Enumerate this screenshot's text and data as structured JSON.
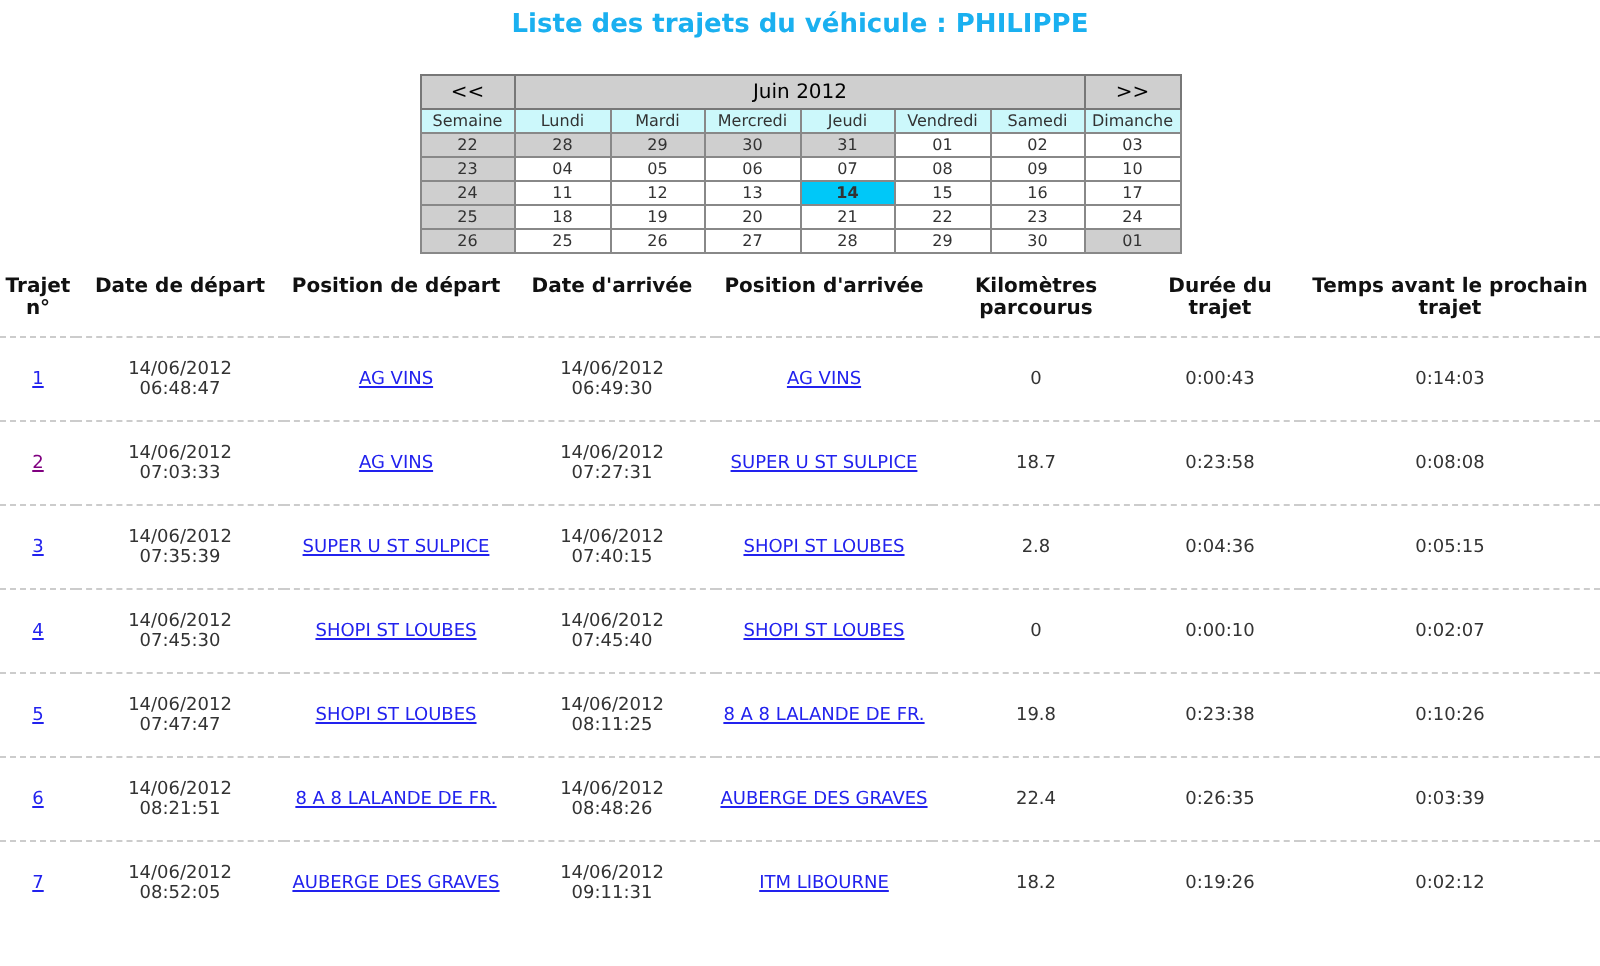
{
  "title": "Liste des trajets du véhicule : PHILIPPE",
  "calendar": {
    "prev": "<<",
    "month": "Juin 2012",
    "next": ">>",
    "week_header": "Semaine",
    "weekdays": [
      "Lundi",
      "Mardi",
      "Mercredi",
      "Jeudi",
      "Vendredi",
      "Samedi",
      "Dimanche"
    ],
    "weeks": [
      {
        "week": "22",
        "days": [
          {
            "day": "28",
            "outside": true,
            "selected": false
          },
          {
            "day": "29",
            "outside": true,
            "selected": false
          },
          {
            "day": "30",
            "outside": true,
            "selected": false
          },
          {
            "day": "31",
            "outside": true,
            "selected": false
          },
          {
            "day": "01",
            "outside": false,
            "selected": false
          },
          {
            "day": "02",
            "outside": false,
            "selected": false
          },
          {
            "day": "03",
            "outside": false,
            "selected": false
          }
        ]
      },
      {
        "week": "23",
        "days": [
          {
            "day": "04",
            "outside": false,
            "selected": false
          },
          {
            "day": "05",
            "outside": false,
            "selected": false
          },
          {
            "day": "06",
            "outside": false,
            "selected": false
          },
          {
            "day": "07",
            "outside": false,
            "selected": false
          },
          {
            "day": "08",
            "outside": false,
            "selected": false
          },
          {
            "day": "09",
            "outside": false,
            "selected": false
          },
          {
            "day": "10",
            "outside": false,
            "selected": false
          }
        ]
      },
      {
        "week": "24",
        "days": [
          {
            "day": "11",
            "outside": false,
            "selected": false
          },
          {
            "day": "12",
            "outside": false,
            "selected": false
          },
          {
            "day": "13",
            "outside": false,
            "selected": false
          },
          {
            "day": "14",
            "outside": false,
            "selected": true
          },
          {
            "day": "15",
            "outside": false,
            "selected": false
          },
          {
            "day": "16",
            "outside": false,
            "selected": false
          },
          {
            "day": "17",
            "outside": false,
            "selected": false
          }
        ]
      },
      {
        "week": "25",
        "days": [
          {
            "day": "18",
            "outside": false,
            "selected": false
          },
          {
            "day": "19",
            "outside": false,
            "selected": false
          },
          {
            "day": "20",
            "outside": false,
            "selected": false
          },
          {
            "day": "21",
            "outside": false,
            "selected": false
          },
          {
            "day": "22",
            "outside": false,
            "selected": false
          },
          {
            "day": "23",
            "outside": false,
            "selected": false
          },
          {
            "day": "24",
            "outside": false,
            "selected": false
          }
        ]
      },
      {
        "week": "26",
        "days": [
          {
            "day": "25",
            "outside": false,
            "selected": false
          },
          {
            "day": "26",
            "outside": false,
            "selected": false
          },
          {
            "day": "27",
            "outside": false,
            "selected": false
          },
          {
            "day": "28",
            "outside": false,
            "selected": false
          },
          {
            "day": "29",
            "outside": false,
            "selected": false
          },
          {
            "day": "30",
            "outside": false,
            "selected": false
          },
          {
            "day": "01",
            "outside": true,
            "selected": false
          }
        ]
      }
    ]
  },
  "table": {
    "columns": [
      "Trajet n°",
      "Date de départ",
      "Position de départ",
      "Date d'arrivée",
      "Position d'arrivée",
      "Kilomètres parcourus",
      "Durée du trajet",
      "Temps avant le prochain trajet"
    ],
    "rows": [
      {
        "trip": "1",
        "visited": false,
        "depart_date": "14/06/2012",
        "depart_time": "06:48:47",
        "depart_pos": "AG VINS",
        "arrive_date": "14/06/2012",
        "arrive_time": "06:49:30",
        "arrive_pos": "AG VINS",
        "km": "0",
        "duration": "0:00:43",
        "until_next": "0:14:03"
      },
      {
        "trip": "2",
        "visited": true,
        "depart_date": "14/06/2012",
        "depart_time": "07:03:33",
        "depart_pos": "AG VINS",
        "arrive_date": "14/06/2012",
        "arrive_time": "07:27:31",
        "arrive_pos": "SUPER U ST SULPICE",
        "km": "18.7",
        "duration": "0:23:58",
        "until_next": "0:08:08"
      },
      {
        "trip": "3",
        "visited": false,
        "depart_date": "14/06/2012",
        "depart_time": "07:35:39",
        "depart_pos": "SUPER U ST SULPICE",
        "arrive_date": "14/06/2012",
        "arrive_time": "07:40:15",
        "arrive_pos": "SHOPI ST LOUBES",
        "km": "2.8",
        "duration": "0:04:36",
        "until_next": "0:05:15"
      },
      {
        "trip": "4",
        "visited": false,
        "depart_date": "14/06/2012",
        "depart_time": "07:45:30",
        "depart_pos": "SHOPI ST LOUBES",
        "arrive_date": "14/06/2012",
        "arrive_time": "07:45:40",
        "arrive_pos": "SHOPI ST LOUBES",
        "km": "0",
        "duration": "0:00:10",
        "until_next": "0:02:07"
      },
      {
        "trip": "5",
        "visited": false,
        "depart_date": "14/06/2012",
        "depart_time": "07:47:47",
        "depart_pos": "SHOPI ST LOUBES",
        "arrive_date": "14/06/2012",
        "arrive_time": "08:11:25",
        "arrive_pos": "8 A 8 LALANDE DE FR.",
        "km": "19.8",
        "duration": "0:23:38",
        "until_next": "0:10:26"
      },
      {
        "trip": "6",
        "visited": false,
        "depart_date": "14/06/2012",
        "depart_time": "08:21:51",
        "depart_pos": "8 A 8 LALANDE DE FR.",
        "arrive_date": "14/06/2012",
        "arrive_time": "08:48:26",
        "arrive_pos": "AUBERGE DES GRAVES",
        "km": "22.4",
        "duration": "0:26:35",
        "until_next": "0:03:39"
      },
      {
        "trip": "7",
        "visited": false,
        "depart_date": "14/06/2012",
        "depart_time": "08:52:05",
        "depart_pos": "AUBERGE DES GRAVES",
        "arrive_date": "14/06/2012",
        "arrive_time": "09:11:31",
        "arrive_pos": "ITM LIBOURNE",
        "km": "18.2",
        "duration": "0:19:26",
        "until_next": "0:02:12"
      }
    ]
  }
}
